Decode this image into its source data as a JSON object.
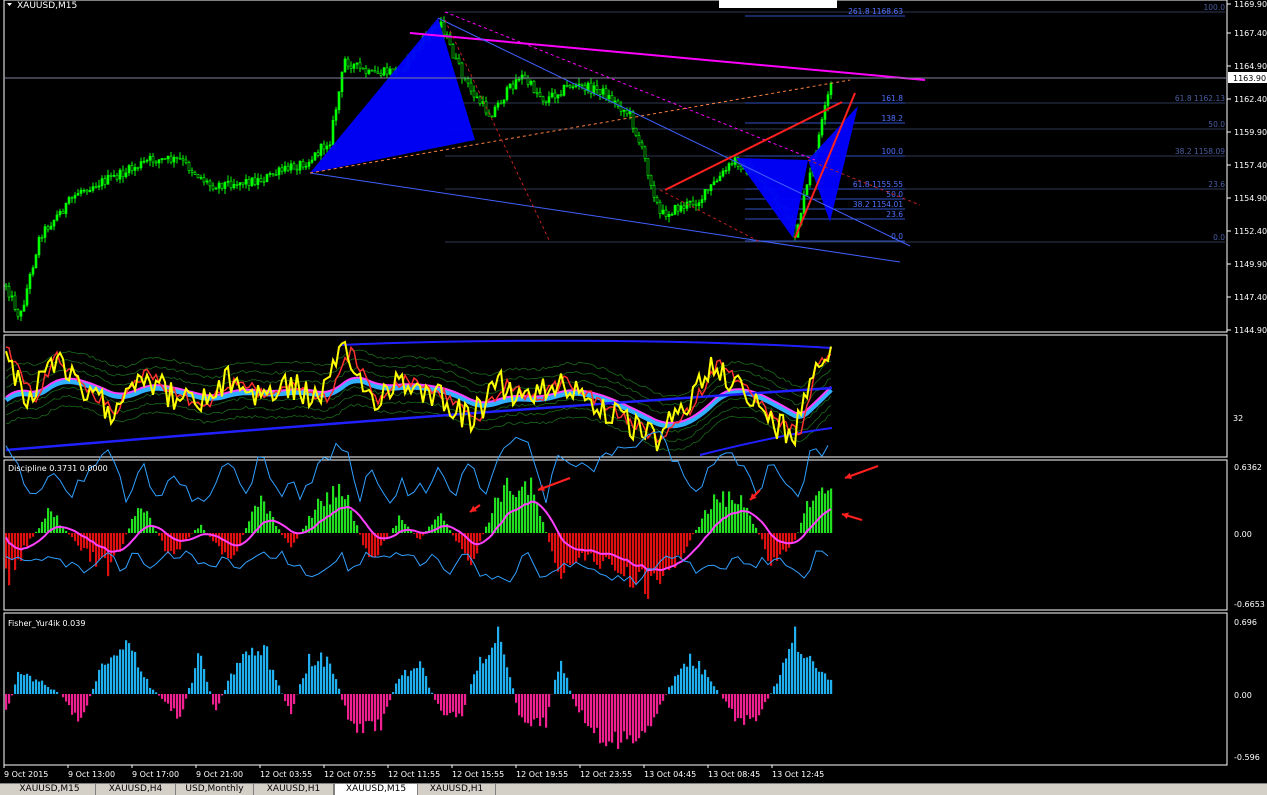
{
  "main": {
    "symbol_label": "XAUUSD,M15",
    "price_ticks": [
      "1169.90",
      "1167.40",
      "1164.90",
      "1162.40",
      "1159.90",
      "1157.40",
      "1154.90",
      "1152.40",
      "1149.90",
      "1147.40",
      "1144.90"
    ],
    "current_price": "1163.90",
    "fib_right": [
      {
        "label": "100.0"
      },
      {
        "label": "61.8 1162.13"
      },
      {
        "label": "50.0"
      },
      {
        "label": "38.2 1158.09"
      },
      {
        "label": "23.6"
      },
      {
        "label": "0.0"
      }
    ],
    "fib_mid": [
      {
        "label": "261.8 1168.63"
      },
      {
        "label": "161.8"
      },
      {
        "label": "138.2"
      },
      {
        "label": "100.0"
      },
      {
        "label": "61.8 1155.55"
      },
      {
        "label": "50.0"
      },
      {
        "label": "38.2 1154.01"
      },
      {
        "label": "23.6"
      },
      {
        "label": "0.0"
      }
    ],
    "colors": {
      "candle": "#00ff00",
      "pattern": "#0000ff",
      "trendline": "#ff00ff",
      "channel": "#ff2020",
      "fib": "#4060ff"
    }
  },
  "osc": {
    "tick": "32"
  },
  "discipline": {
    "label": "Discipline 0.3731 0.0000",
    "ticks": [
      "0.6362",
      "0.00",
      "-0.6653"
    ]
  },
  "fisher": {
    "label": "Fisher_Yur4ik 0.039",
    "ticks": [
      "0.696",
      "0.00",
      "-0.596"
    ]
  },
  "time_labels": [
    "9 Oct 2015",
    "9 Oct 13:00",
    "9 Oct 17:00",
    "9 Oct 21:00",
    "12 Oct 03:55",
    "12 Oct 07:55",
    "12 Oct 11:55",
    "12 Oct 15:55",
    "12 Oct 19:55",
    "12 Oct 23:55",
    "13 Oct 04:45",
    "13 Oct 08:45",
    "13 Oct 12:45"
  ],
  "chart_data": {
    "type": "line",
    "series": [
      {
        "name": "XAUUSD,M15",
        "x": [
          "9 Oct 2015",
          "9 Oct 13:00",
          "9 Oct 17:00",
          "9 Oct 21:00",
          "12 Oct 03:55",
          "12 Oct 07:55",
          "12 Oct 11:55",
          "12 Oct 15:55",
          "12 Oct 19:55",
          "12 Oct 23:55",
          "13 Oct 04:45",
          "13 Oct 08:45",
          "13 Oct 12:45"
        ],
        "values": [
          1146.0,
          1152.8,
          1157.5,
          1156.5,
          1157.0,
          1165.0,
          1168.5,
          1160.5,
          1163.5,
          1161.5,
          1154.0,
          1156.5,
          1163.9
        ]
      }
    ],
    "ylim": [
      1144.9,
      1169.9
    ]
  },
  "tabs": [
    {
      "label": "XAUUSD,M15",
      "active": false
    },
    {
      "label": "XAUUSD,H4",
      "active": false
    },
    {
      "label": "USD,Monthly",
      "active": false
    },
    {
      "label": "XAUUSD,H1",
      "active": false
    },
    {
      "label": "XAUUSD,M15",
      "active": true
    },
    {
      "label": "XAUUSD,H1",
      "active": false
    }
  ]
}
